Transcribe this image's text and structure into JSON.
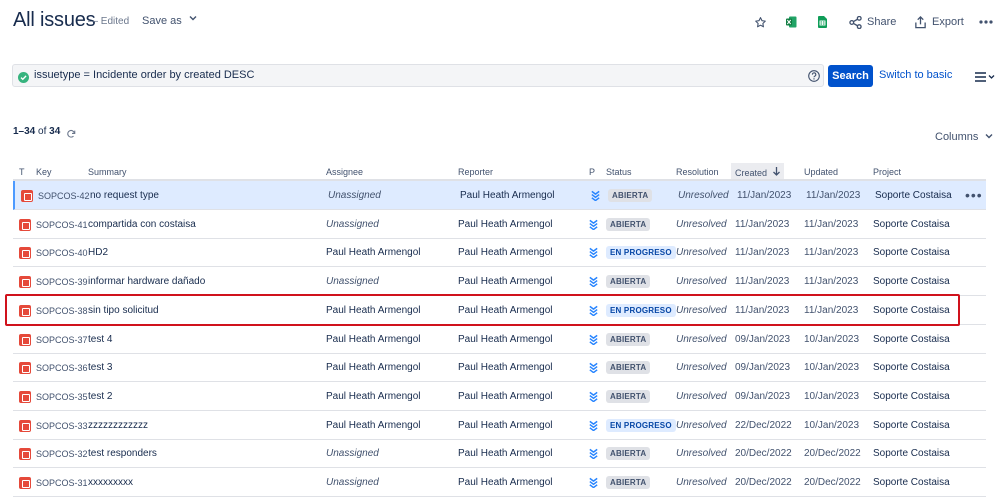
{
  "header": {
    "title": "All issues",
    "edited": "— Edited",
    "save_as": "Save as",
    "share": "Share",
    "export": "Export"
  },
  "search": {
    "query": "issuetype = Incidente order by created DESC",
    "search_button": "Search",
    "switch_label": "Switch to basic"
  },
  "results": {
    "range": "1–34",
    "of": "of",
    "total": "34",
    "columns_label": "Columns"
  },
  "table": {
    "headers": {
      "t": "T",
      "key": "Key",
      "summary": "Summary",
      "assignee": "Assignee",
      "reporter": "Reporter",
      "p": "P",
      "status": "Status",
      "resolution": "Resolution",
      "created": "Created",
      "updated": "Updated",
      "project": "Project"
    },
    "rows": [
      {
        "key": "SOPCOS-42",
        "summary": "no request type",
        "assignee": "Unassigned",
        "reporter": "Paul Heath Armengol",
        "status": "ABIERTA",
        "resolution": "Unresolved",
        "created": "11/Jan/2023",
        "updated": "11/Jan/2023",
        "project": "Soporte Costaisa"
      },
      {
        "key": "SOPCOS-41",
        "summary": "compartida con costaisa",
        "assignee": "Unassigned",
        "reporter": "Paul Heath Armengol",
        "status": "ABIERTA",
        "resolution": "Unresolved",
        "created": "11/Jan/2023",
        "updated": "11/Jan/2023",
        "project": "Soporte Costaisa"
      },
      {
        "key": "SOPCOS-40",
        "summary": "HD2",
        "assignee": "Paul Heath Armengol",
        "reporter": "Paul Heath Armengol",
        "status": "EN PROGRESO",
        "resolution": "Unresolved",
        "created": "11/Jan/2023",
        "updated": "11/Jan/2023",
        "project": "Soporte Costaisa"
      },
      {
        "key": "SOPCOS-39",
        "summary": "informar hardware dañado",
        "assignee": "Unassigned",
        "reporter": "Paul Heath Armengol",
        "status": "ABIERTA",
        "resolution": "Unresolved",
        "created": "11/Jan/2023",
        "updated": "11/Jan/2023",
        "project": "Soporte Costaisa"
      },
      {
        "key": "SOPCOS-38",
        "summary": "sin tipo solicitud",
        "assignee": "Paul Heath Armengol",
        "reporter": "Paul Heath Armengol",
        "status": "EN PROGRESO",
        "resolution": "Unresolved",
        "created": "11/Jan/2023",
        "updated": "11/Jan/2023",
        "project": "Soporte Costaisa"
      },
      {
        "key": "SOPCOS-37",
        "summary": "test 4",
        "assignee": "Paul Heath Armengol",
        "reporter": "Paul Heath Armengol",
        "status": "ABIERTA",
        "resolution": "Unresolved",
        "created": "09/Jan/2023",
        "updated": "10/Jan/2023",
        "project": "Soporte Costaisa"
      },
      {
        "key": "SOPCOS-36",
        "summary": "test 3",
        "assignee": "Paul Heath Armengol",
        "reporter": "Paul Heath Armengol",
        "status": "ABIERTA",
        "resolution": "Unresolved",
        "created": "09/Jan/2023",
        "updated": "10/Jan/2023",
        "project": "Soporte Costaisa"
      },
      {
        "key": "SOPCOS-35",
        "summary": "test 2",
        "assignee": "Paul Heath Armengol",
        "reporter": "Paul Heath Armengol",
        "status": "ABIERTA",
        "resolution": "Unresolved",
        "created": "09/Jan/2023",
        "updated": "10/Jan/2023",
        "project": "Soporte Costaisa"
      },
      {
        "key": "SOPCOS-33",
        "summary": "zzzzzzzzzzzz",
        "assignee": "Paul Heath Armengol",
        "reporter": "Paul Heath Armengol",
        "status": "EN PROGRESO",
        "resolution": "Unresolved",
        "created": "22/Dec/2022",
        "updated": "10/Jan/2023",
        "project": "Soporte Costaisa"
      },
      {
        "key": "SOPCOS-32",
        "summary": "test responders",
        "assignee": "Unassigned",
        "reporter": "Paul Heath Armengol",
        "status": "ABIERTA",
        "resolution": "Unresolved",
        "created": "20/Dec/2022",
        "updated": "20/Dec/2022",
        "project": "Soporte Costaisa"
      },
      {
        "key": "SOPCOS-31",
        "summary": "xxxxxxxxx",
        "assignee": "Unassigned",
        "reporter": "Paul Heath Armengol",
        "status": "ABIERTA",
        "resolution": "Unresolved",
        "created": "20/Dec/2022",
        "updated": "20/Dec/2022",
        "project": "Soporte Costaisa"
      }
    ]
  },
  "colors": {
    "accent": "#0052cc",
    "highlight_box": "#d0121c",
    "issue_type": "#e5493a",
    "priority": "#2684ff"
  },
  "icons": [
    "star-icon",
    "excel-icon",
    "sheets-icon",
    "share-icon",
    "export-icon",
    "more-icon",
    "check-circle-icon",
    "help-icon",
    "menu-icon",
    "refresh-icon",
    "incident-type-icon",
    "priority-lowest-icon",
    "sort-down-icon"
  ]
}
